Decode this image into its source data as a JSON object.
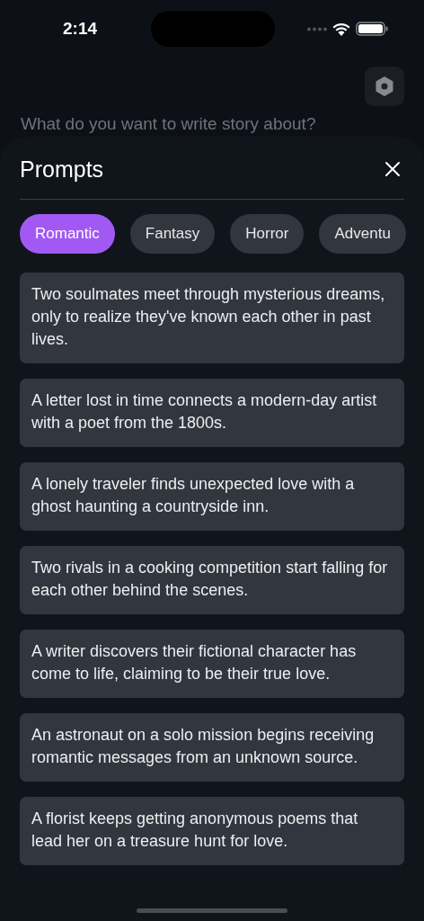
{
  "status_bar": {
    "time": "2:14"
  },
  "input": {
    "placeholder": "What do you want to write story about?"
  },
  "sheet": {
    "title": "Prompts"
  },
  "categories": [
    {
      "label": "Romantic",
      "selected": true
    },
    {
      "label": "Fantasy",
      "selected": false
    },
    {
      "label": "Horror",
      "selected": false
    },
    {
      "label": "Adventu",
      "selected": false
    }
  ],
  "prompts": [
    "Two soulmates meet through mysterious dreams, only to realize they've known each other in past lives.",
    "A letter lost in time connects a modern-day artist with a poet from the 1800s.",
    "A lonely traveler finds unexpected love with a ghost haunting a countryside inn.",
    "Two rivals in a cooking competition start falling for each other behind the scenes.",
    "A writer discovers their fictional character has come to life, claiming to be their true love.",
    "An astronaut on a solo mission begins receiving romantic messages from an unknown source.",
    "A florist keeps getting anonymous poems that lead her on a treasure hunt for love."
  ]
}
